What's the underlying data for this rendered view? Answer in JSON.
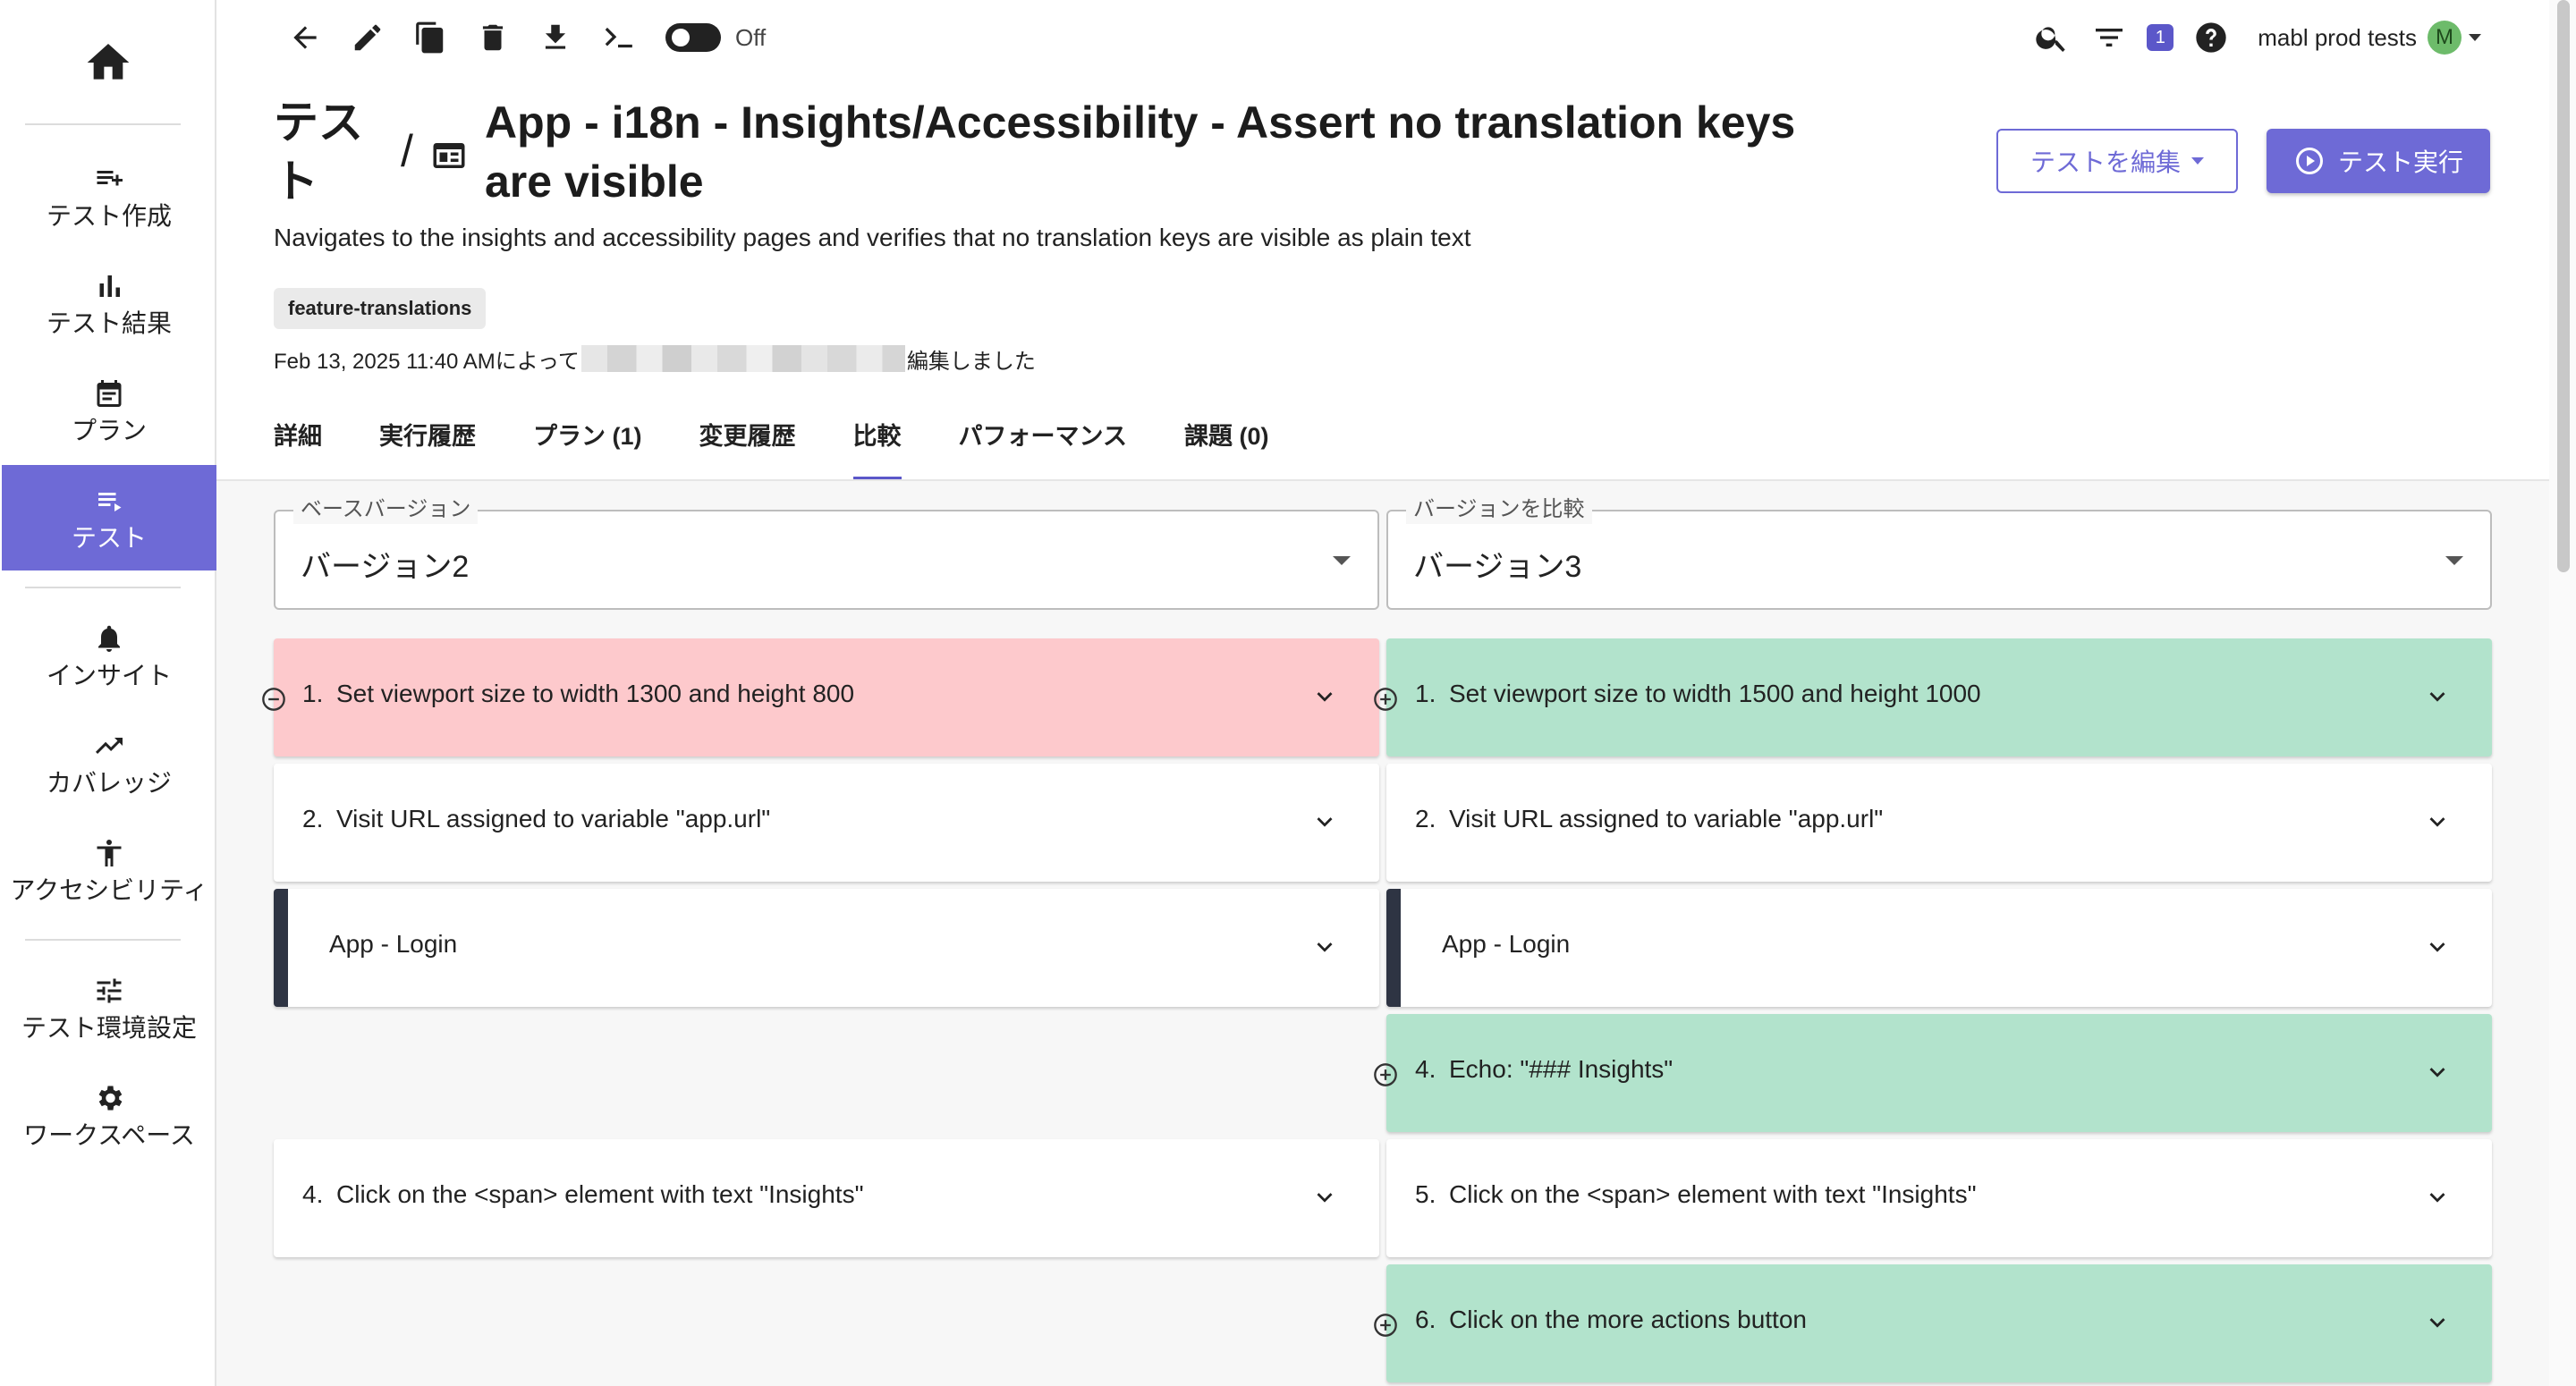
{
  "sidebar": {
    "items": [
      {
        "label": "テスト作成",
        "icon": "playlist-add-icon"
      },
      {
        "label": "テスト結果",
        "icon": "bar-chart-icon"
      },
      {
        "label": "プラン",
        "icon": "calendar-icon"
      },
      {
        "label": "テスト",
        "icon": "list-icon",
        "active": true
      },
      {
        "label": "インサイト",
        "icon": "bell-icon"
      },
      {
        "label": "カバレッジ",
        "icon": "trending-up-icon"
      },
      {
        "label": "アクセシビリティ",
        "icon": "accessibility-icon"
      },
      {
        "label": "テスト環境設定",
        "icon": "tune-icon"
      },
      {
        "label": "ワークスペース",
        "icon": "gear-icon"
      }
    ]
  },
  "toolbar": {
    "toggle_label": "Off"
  },
  "header": {
    "notification_count": "1",
    "workspace_name": "mabl prod tests",
    "avatar_initial": "M"
  },
  "test": {
    "breadcrumb_root": "テスト",
    "breadcrumb_separator": "/",
    "title": "App - i18n - Insights/Accessibility - Assert no translation keys are visible",
    "description": "Navigates to the insights and accessibility pages and verifies that no translation keys are visible as plain text",
    "tag": "feature-translations",
    "edited_prefix": "Feb 13, 2025 11:40 AMによって",
    "edited_suffix": "編集しました"
  },
  "actions": {
    "edit_label": "テストを編集",
    "run_label": "テスト実行"
  },
  "tabs": [
    {
      "label": "詳細"
    },
    {
      "label": "実行履歴"
    },
    {
      "label": "プラン (1)"
    },
    {
      "label": "変更履歴"
    },
    {
      "label": "比較",
      "active": true
    },
    {
      "label": "パフォーマンス"
    },
    {
      "label": "課題 (0)"
    }
  ],
  "compare": {
    "base_label": "ベースバージョン",
    "base_value": "バージョン2",
    "compare_label": "バージョンを比較",
    "compare_value": "バージョン3",
    "left_steps": [
      {
        "num": "1.",
        "text": "Set viewport size to width 1300 and height 800",
        "status": "removed"
      },
      {
        "num": "2.",
        "text": "Visit URL assigned to variable \"app.url\"",
        "status": "same"
      },
      {
        "num": "",
        "text": "App - Login",
        "status": "flow"
      },
      {
        "num": "4.",
        "text": "Click on the <span> element with text \"Insights\"",
        "status": "same"
      }
    ],
    "right_steps": [
      {
        "num": "1.",
        "text": "Set viewport size to width 1500 and height 1000",
        "status": "added"
      },
      {
        "num": "2.",
        "text": "Visit URL assigned to variable \"app.url\"",
        "status": "same"
      },
      {
        "num": "",
        "text": "App - Login",
        "status": "flow"
      },
      {
        "num": "4.",
        "text": "Echo: \"### Insights\"",
        "status": "added"
      },
      {
        "num": "5.",
        "text": "Click on the <span> element with text \"Insights\"",
        "status": "same"
      },
      {
        "num": "6.",
        "text": "Click on the more actions button",
        "status": "added"
      }
    ]
  }
}
